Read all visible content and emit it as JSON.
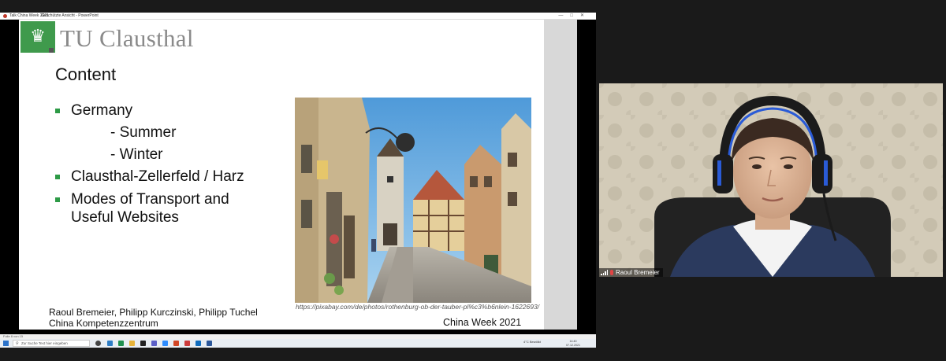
{
  "window": {
    "app_title": "Talk China Week 2021",
    "title_suffix": "Geschützte Ansicht - PowerPoint"
  },
  "slide": {
    "university_name": "TU Clausthal",
    "heading": "Content",
    "bullets": [
      {
        "text": "Germany"
      },
      {
        "text": "Clausthal-Zellerfeld / Harz"
      },
      {
        "text": "Modes of Transport and"
      },
      {
        "text": "Useful Websites"
      }
    ],
    "sub_bullets": [
      "- Summer",
      "- Winter"
    ],
    "photo_caption": "https://pixabay.com/de/photos/rothenburg-ob-der-tauber-pl%c3%b6nlein-1622693/",
    "authors_line1": "Raoul Bremeier, Philipp Kurczinski, Philipp Tuchel",
    "authors_line2": "China Kompetenzzentrum",
    "event": "China Week 2021",
    "slide_number": "8"
  },
  "status_bar": {
    "left": "Folie 8 von 15"
  },
  "taskbar": {
    "search_placeholder": "Zur Suche Text hier eingeben",
    "weather": "4°C Bewölkt",
    "time": "14:40",
    "date": "07.12.2021"
  },
  "video": {
    "participant_name": "Raoul Bremeier",
    "mic_state": "muted",
    "signal_level": 4
  },
  "colors": {
    "brand_green": "#3f9a4c",
    "bullet_green": "#2d9a46",
    "app_background": "#1a1a1a"
  }
}
